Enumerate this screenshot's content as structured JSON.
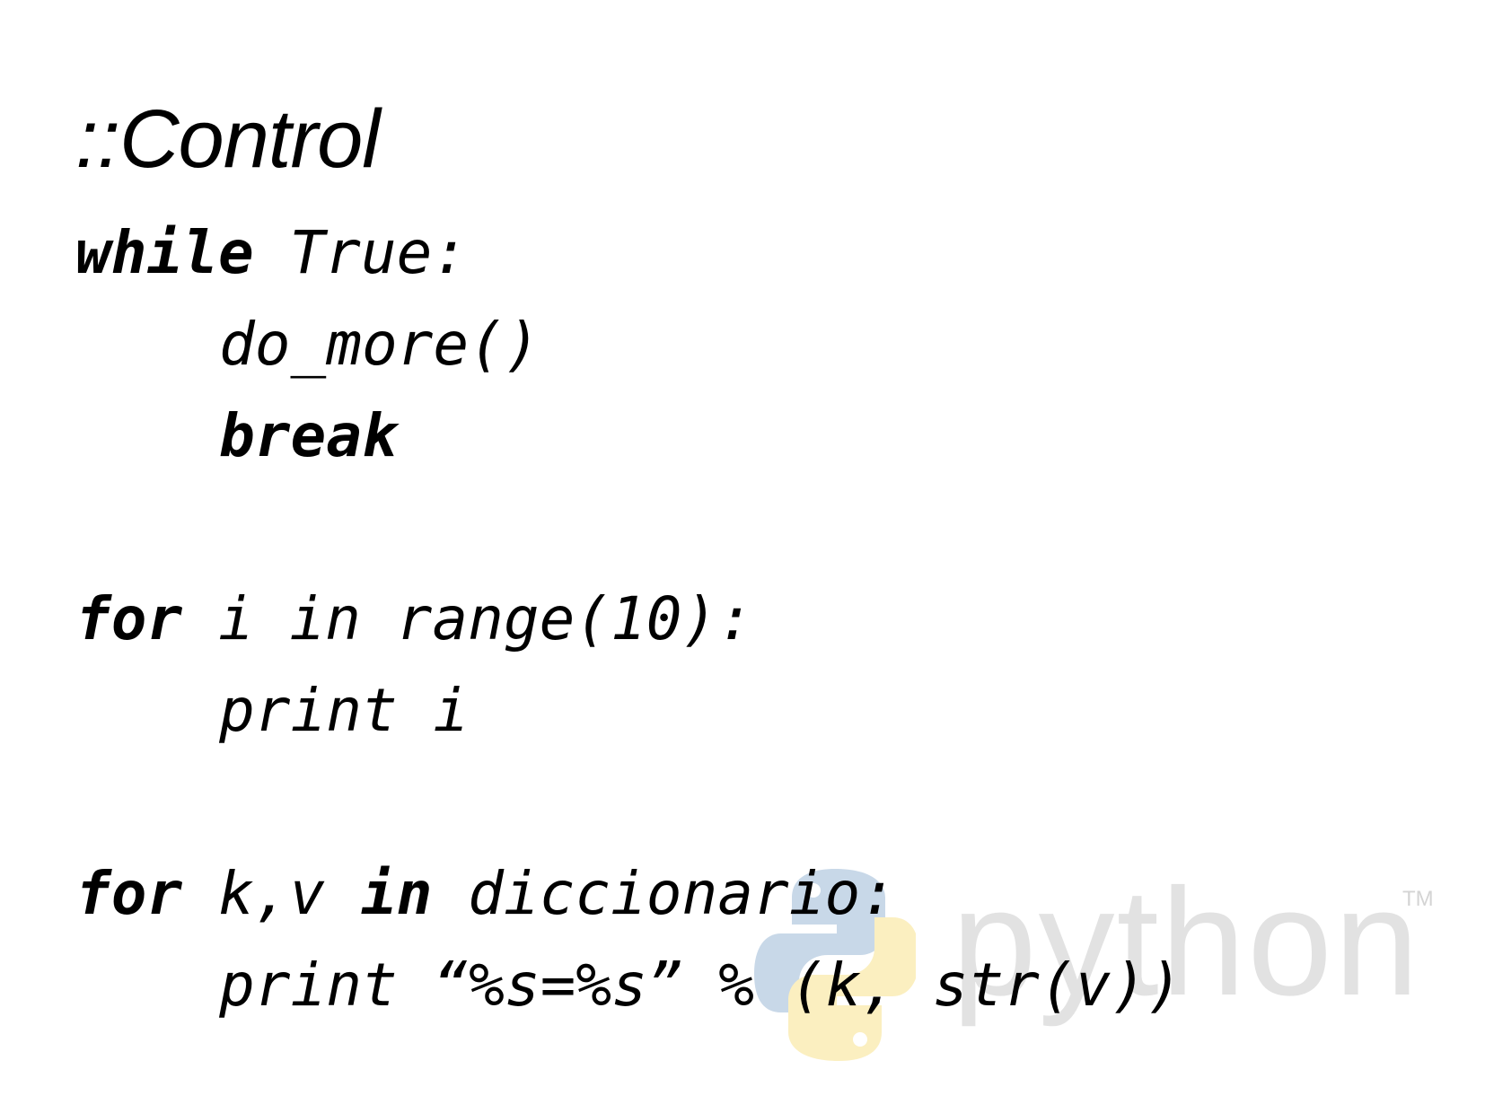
{
  "slide": {
    "title": "::Control",
    "lines": [
      {
        "kw": "while",
        "rest": " True:"
      },
      {
        "rest": "do_more()"
      },
      {
        "kw": "break"
      },
      {
        "kw": "for",
        "rest": " i in range(10):"
      },
      {
        "rest": "print i"
      },
      {
        "kw": "for",
        "mid": " k,v ",
        "kw2": "in",
        "rest": " diccionario:"
      },
      {
        "rest": "print “%s=%s” % (k, str(v))"
      }
    ]
  },
  "watermark": {
    "logo_icon": "python-snakes-icon",
    "word": "python",
    "tm": "TM",
    "colors": {
      "blue": "#c8d8e8",
      "yellow": "#fbefc0",
      "text": "#e2e2e2"
    }
  }
}
